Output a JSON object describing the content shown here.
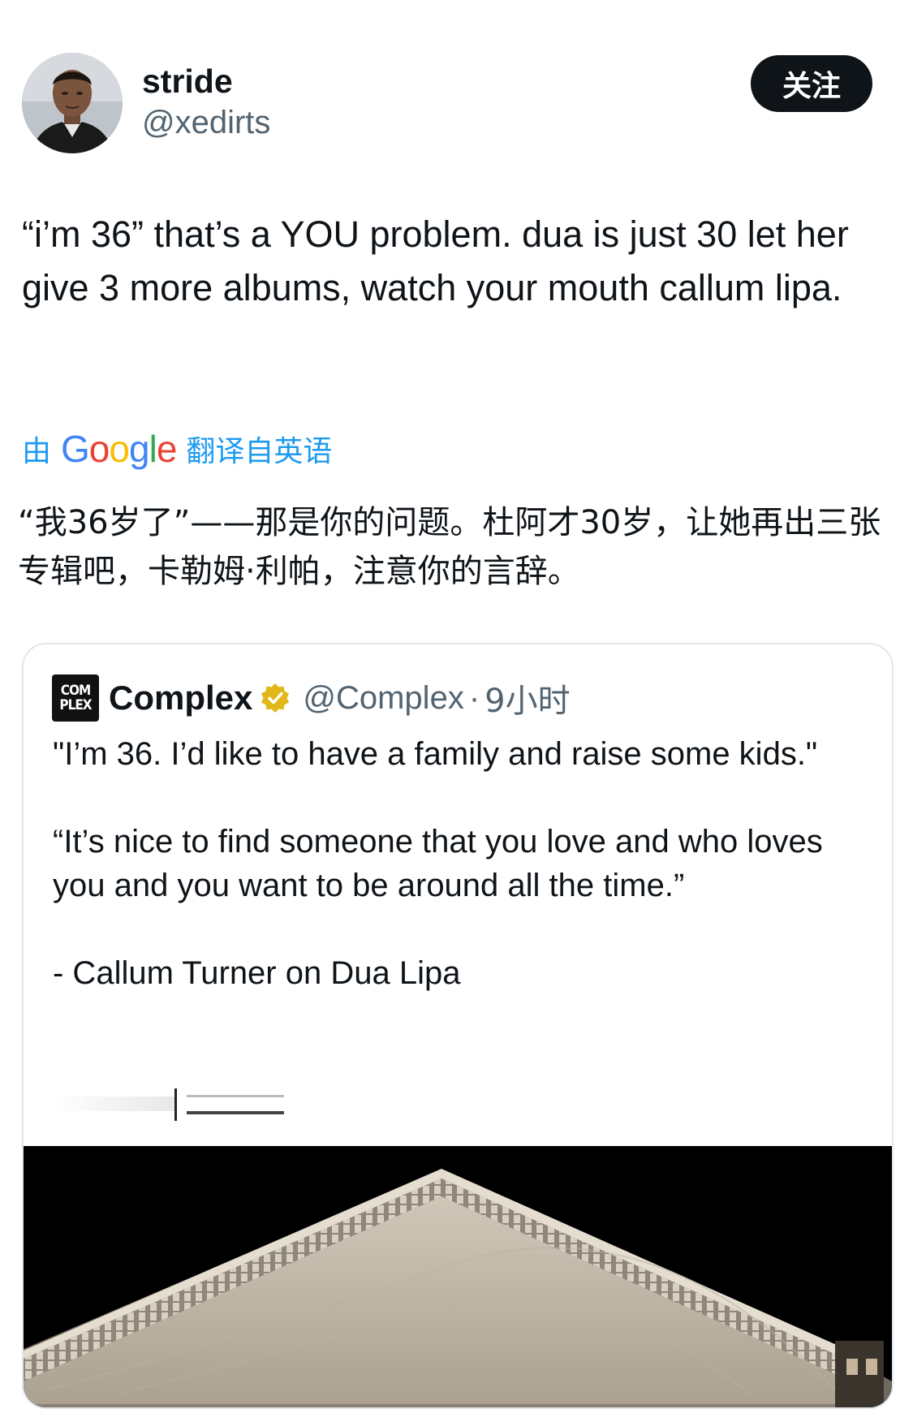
{
  "author": {
    "display_name": "stride",
    "handle": "@xedirts",
    "follow_label": "关注"
  },
  "tweet": {
    "text": "“i’m 36” that’s a YOU problem. dua is just 30 let her give 3 more albums, watch your mouth callum lipa."
  },
  "translation": {
    "prefix": "由",
    "provider": "Google",
    "suffix": "翻译自英语",
    "text": "“我36岁了”——那是你的问题。杜阿才30岁，让她再出三张专辑吧，卡勒姆·利帕，注意你的言辞。",
    "colors": {
      "blue": "#4285F4",
      "red": "#EA4335",
      "yellow": "#FBBC05",
      "green": "#34A853",
      "link": "#1d9bf0"
    }
  },
  "quoted_tweet": {
    "logo_line1": "COM",
    "logo_line2": "PLEX",
    "name": "Complex",
    "verified_icon": "verified-gold-badge-icon",
    "handle": "@Complex",
    "separator": "·",
    "time": "9小时",
    "paragraphs": [
      "\"I’m 36. I’d like to have a family and raise some kids.\"",
      "“It’s nice to find someone that you love and who loves you and you want to be around all the time.”",
      "- Callum Turner on Dua Lipa"
    ],
    "media_icon": "building-pediment-photo"
  }
}
